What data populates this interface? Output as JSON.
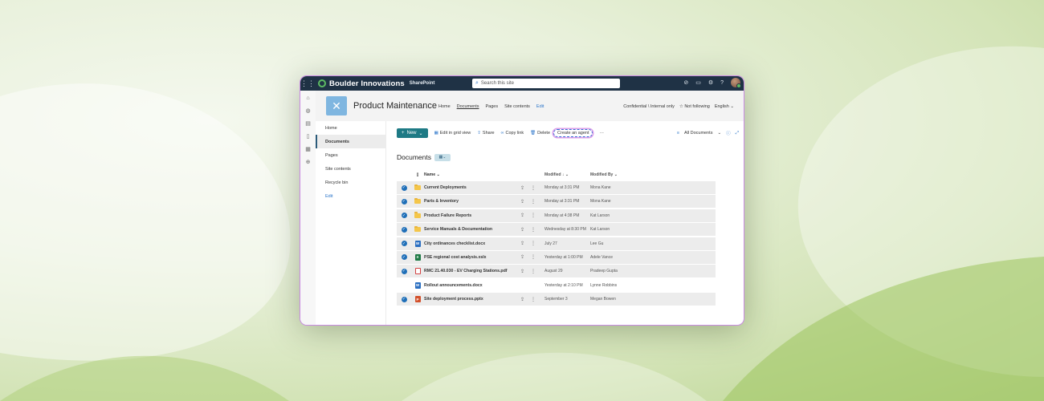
{
  "suite": {
    "brand": "Boulder Innovations",
    "app": "SharePoint",
    "search_placeholder": "Search this site"
  },
  "site": {
    "title": "Product Maintenance",
    "nav": [
      "Home",
      "Documents",
      "Pages",
      "Site contents",
      "Edit"
    ],
    "sensitivity": "Confidential \\ Internal only",
    "follow": "☆ Not following",
    "language": "English ⌄"
  },
  "leftnav": {
    "items": [
      "Home",
      "Documents",
      "Pages",
      "Site contents",
      "Recycle bin",
      "Edit"
    ]
  },
  "commands": {
    "new": "New",
    "edit_grid": "Edit in grid view",
    "share": "Share",
    "copy_link": "Copy link",
    "delete": "Delete",
    "create_agent": "Create an agent",
    "more": "···",
    "view": "All Documents"
  },
  "library": {
    "title": "Documents",
    "columns": {
      "name": "Name ⌄",
      "modified": "Modified ↓ ⌄",
      "modified_by": "Modified By ⌄"
    },
    "rows": [
      {
        "name": "Current Deployments",
        "type": "folder",
        "modified": "Monday at 3:31 PM",
        "by": "Mona Kane",
        "selected": true
      },
      {
        "name": "Parts & Inventory",
        "type": "folder",
        "modified": "Monday at 3:31 PM",
        "by": "Mona Kane",
        "selected": true
      },
      {
        "name": "Product Failure Reports",
        "type": "folder",
        "modified": "Monday at 4:38 PM",
        "by": "Kat Larson",
        "selected": true
      },
      {
        "name": "Service Manuals & Documentation",
        "type": "folder",
        "modified": "Wednesday at 8:30 PM",
        "by": "Kat Larson",
        "selected": true
      },
      {
        "name": "City ordinances checklist.docx",
        "type": "docx",
        "modified": "July 27",
        "by": "Lee Gu",
        "selected": true
      },
      {
        "name": "PSE regional cost analysis.xslx",
        "type": "xlsx",
        "modified": "Yesterday at 1:00 PM",
        "by": "Adele Vance",
        "selected": true
      },
      {
        "name": "RMC 21.40.030 - EV Charging Stations.pdf",
        "type": "pdf",
        "modified": "August 29",
        "by": "Pradeep Gupta",
        "selected": true
      },
      {
        "name": "Rollout announcements.docx",
        "type": "docx",
        "modified": "Yesterday at 2:10 PM",
        "by": "Lynne Robbins",
        "selected": false
      },
      {
        "name": "Site deployment process.pptx",
        "type": "pptx",
        "modified": "September 3",
        "by": "Megan Bowen",
        "selected": true
      }
    ]
  }
}
